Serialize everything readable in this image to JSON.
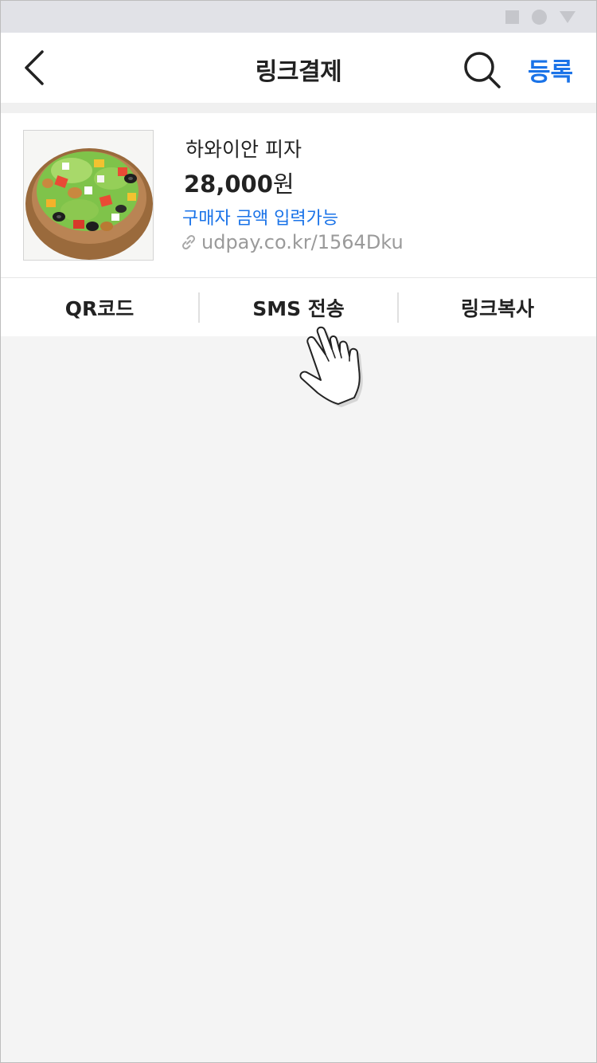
{
  "header": {
    "title": "링크결제",
    "register_label": "등록"
  },
  "product": {
    "name": "하와이안 피자",
    "price": "28,000",
    "price_unit": "원",
    "buyer_note": "구매자 금액 입력가능",
    "link": "udpay.co.kr/1564Dku"
  },
  "actions": {
    "qr_label": "QR코드",
    "sms_label": "SMS 전송",
    "copy_label": "링크복사"
  },
  "icons": {
    "back": "chevron-left-icon",
    "search": "search-icon",
    "link": "link-icon",
    "cursor": "hand-pointer-icon"
  },
  "colors": {
    "accent": "#1a73e8",
    "background": "#f4f4f4"
  }
}
